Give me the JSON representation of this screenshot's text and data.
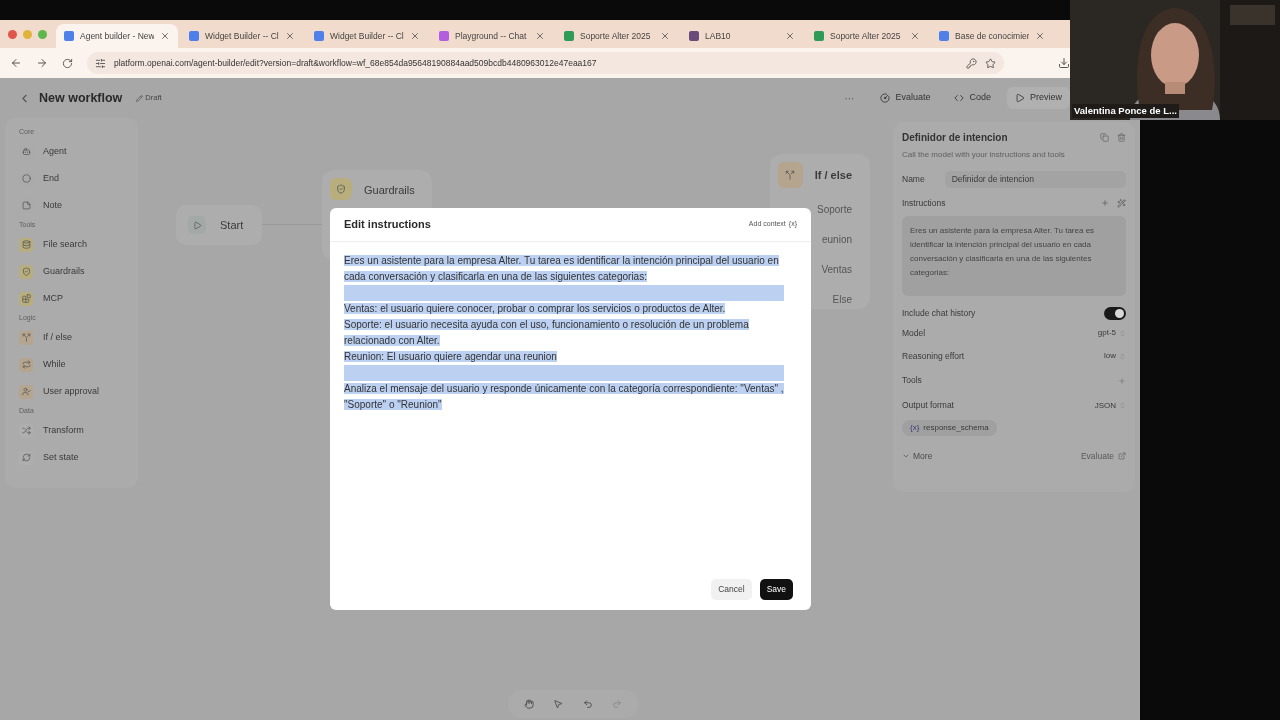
{
  "browser": {
    "tabs": [
      {
        "label": "Agent builder - New",
        "selected": true,
        "color": "#4f7fe8"
      },
      {
        "label": "Widget Builder -- Cl",
        "selected": false,
        "color": "#4f7fe8"
      },
      {
        "label": "Widget Builder -- Cl",
        "selected": false,
        "color": "#4f7fe8"
      },
      {
        "label": "Playground -- Chat",
        "selected": false,
        "color": "#b35de0"
      },
      {
        "label": "Soporte Alter 2025",
        "selected": false,
        "color": "#2e9b57"
      },
      {
        "label": "LAB10",
        "selected": false,
        "color": "#6a4a7a"
      },
      {
        "label": "Soporte Alter 2025",
        "selected": false,
        "color": "#2e9b57"
      },
      {
        "label": "Base de conocimier",
        "selected": false,
        "color": "#4f7fe8"
      }
    ],
    "url": "platform.openai.com/agent-builder/edit?version=draft&workflow=wf_68e854da95648190884aad509bcdb4480963012e47eaa167"
  },
  "header": {
    "title": "New workflow",
    "badge": "Draft",
    "menu": "···",
    "actions": [
      "Evaluate",
      "Code",
      "Preview"
    ]
  },
  "sidebar": [
    {
      "section": "Core",
      "items": [
        "Agent",
        "End",
        "Note"
      ]
    },
    {
      "section": "Tools",
      "items": [
        "File search",
        "Guardrails",
        "MCP"
      ]
    },
    {
      "section": "Logic",
      "items": [
        "If / else",
        "While",
        "User approval"
      ]
    },
    {
      "section": "Data",
      "items": [
        "Transform",
        "Set state"
      ]
    }
  ],
  "canvas": {
    "start": "Start",
    "guardrails": "Guardrails",
    "if_else": {
      "title": "If / else",
      "branches": [
        "Soporte",
        "eunion",
        "Ventas",
        "Else"
      ]
    }
  },
  "dialog": {
    "title": "Edit instructions",
    "add_context": "Add context",
    "add_context_icon": "{x}",
    "selected": true,
    "paragraphs": [
      [
        "Eres un asistente para la empresa Alter. Tu tarea es identificar la intención principal del usuario en cada conversación y clasificarla en una de las siguientes categorias:"
      ],
      [
        "Ventas: el usuario quiere conocer, probar o comprar los servicios o productos de Alter.",
        "Soporte: el usuario necesita ayuda con el uso, funcionamiento o resolución de un problema relacionado con Alter.",
        "Reunion: El usuario quiere agendar una reunion"
      ],
      [
        "Analiza el mensaje del usuario y responde únicamente con la categoría correspondiente: \"Ventas\" , \"Soporte\" o \"Reunion\""
      ]
    ],
    "buttons": [
      "Cancel",
      "Save"
    ]
  },
  "panel": {
    "title": "Definidor de intencion",
    "subtitle": "Call the model with your instructions and tools",
    "name_label": "Name",
    "name_value": "Definidor de intencion",
    "instructions_label": "Instructions",
    "instructions": "Eres un asistente para la empresa Alter. Tu tarea es identificar la intención principal del usuario en cada conversación y clasificarla en una de las siguientes categorias:",
    "chat_history": {
      "label": "Include chat history",
      "on": true
    },
    "settings": [
      {
        "label": "Model",
        "value": "gpt-5"
      },
      {
        "label": "Reasoning effort",
        "value": "low"
      }
    ],
    "tools_label": "Tools",
    "output": {
      "label": "Output format",
      "value": "JSON"
    },
    "schema_icon": "{x}",
    "schema": "response_schema",
    "more": "More",
    "evaluate": "Evaluate"
  },
  "video": {
    "name": "Valentina Ponce de L..."
  }
}
